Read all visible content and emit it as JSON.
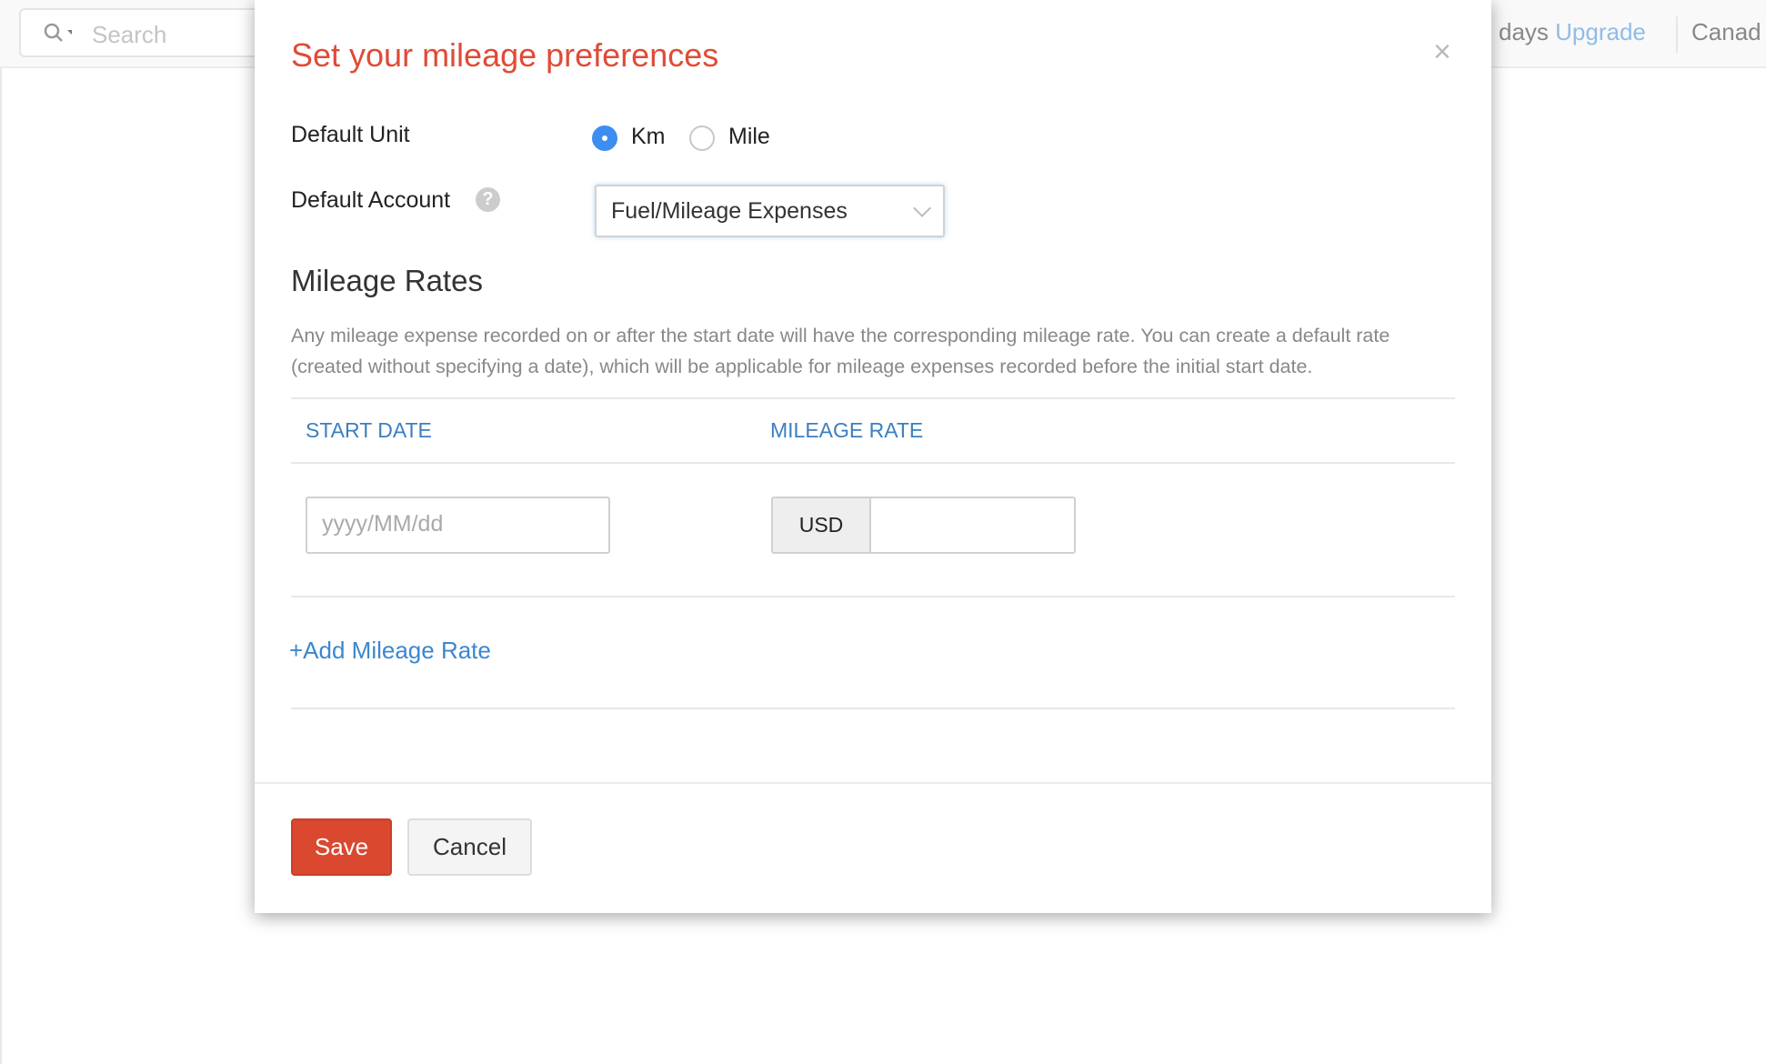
{
  "topbar": {
    "search_placeholder": "Search",
    "trial_text": "days",
    "upgrade_label": "Upgrade",
    "org_name": "Canad"
  },
  "modal": {
    "title": "Set your mileage preferences",
    "close_label": "×",
    "default_unit": {
      "label": "Default Unit",
      "options": [
        "Km",
        "Mile"
      ],
      "selected": "Km"
    },
    "default_account": {
      "label": "Default Account",
      "help": "?",
      "value": "Fuel/Mileage Expenses"
    },
    "rates": {
      "heading": "Mileage Rates",
      "description": "Any mileage expense recorded on or after the start date will have the corresponding mileage rate. You can create a default rate (created without specifying a date), which will be applicable for mileage expenses recorded before the initial start date.",
      "columns": [
        "START DATE",
        "MILEAGE RATE"
      ],
      "row": {
        "date_placeholder": "yyyy/MM/dd",
        "currency": "USD",
        "rate": ""
      },
      "add_label": "+Add Mileage Rate"
    },
    "footer": {
      "save_label": "Save",
      "cancel_label": "Cancel"
    }
  },
  "colors": {
    "accent": "#e04b36",
    "link": "#3b87cf",
    "save": "#d9482f",
    "radio": "#3d8ef0"
  }
}
